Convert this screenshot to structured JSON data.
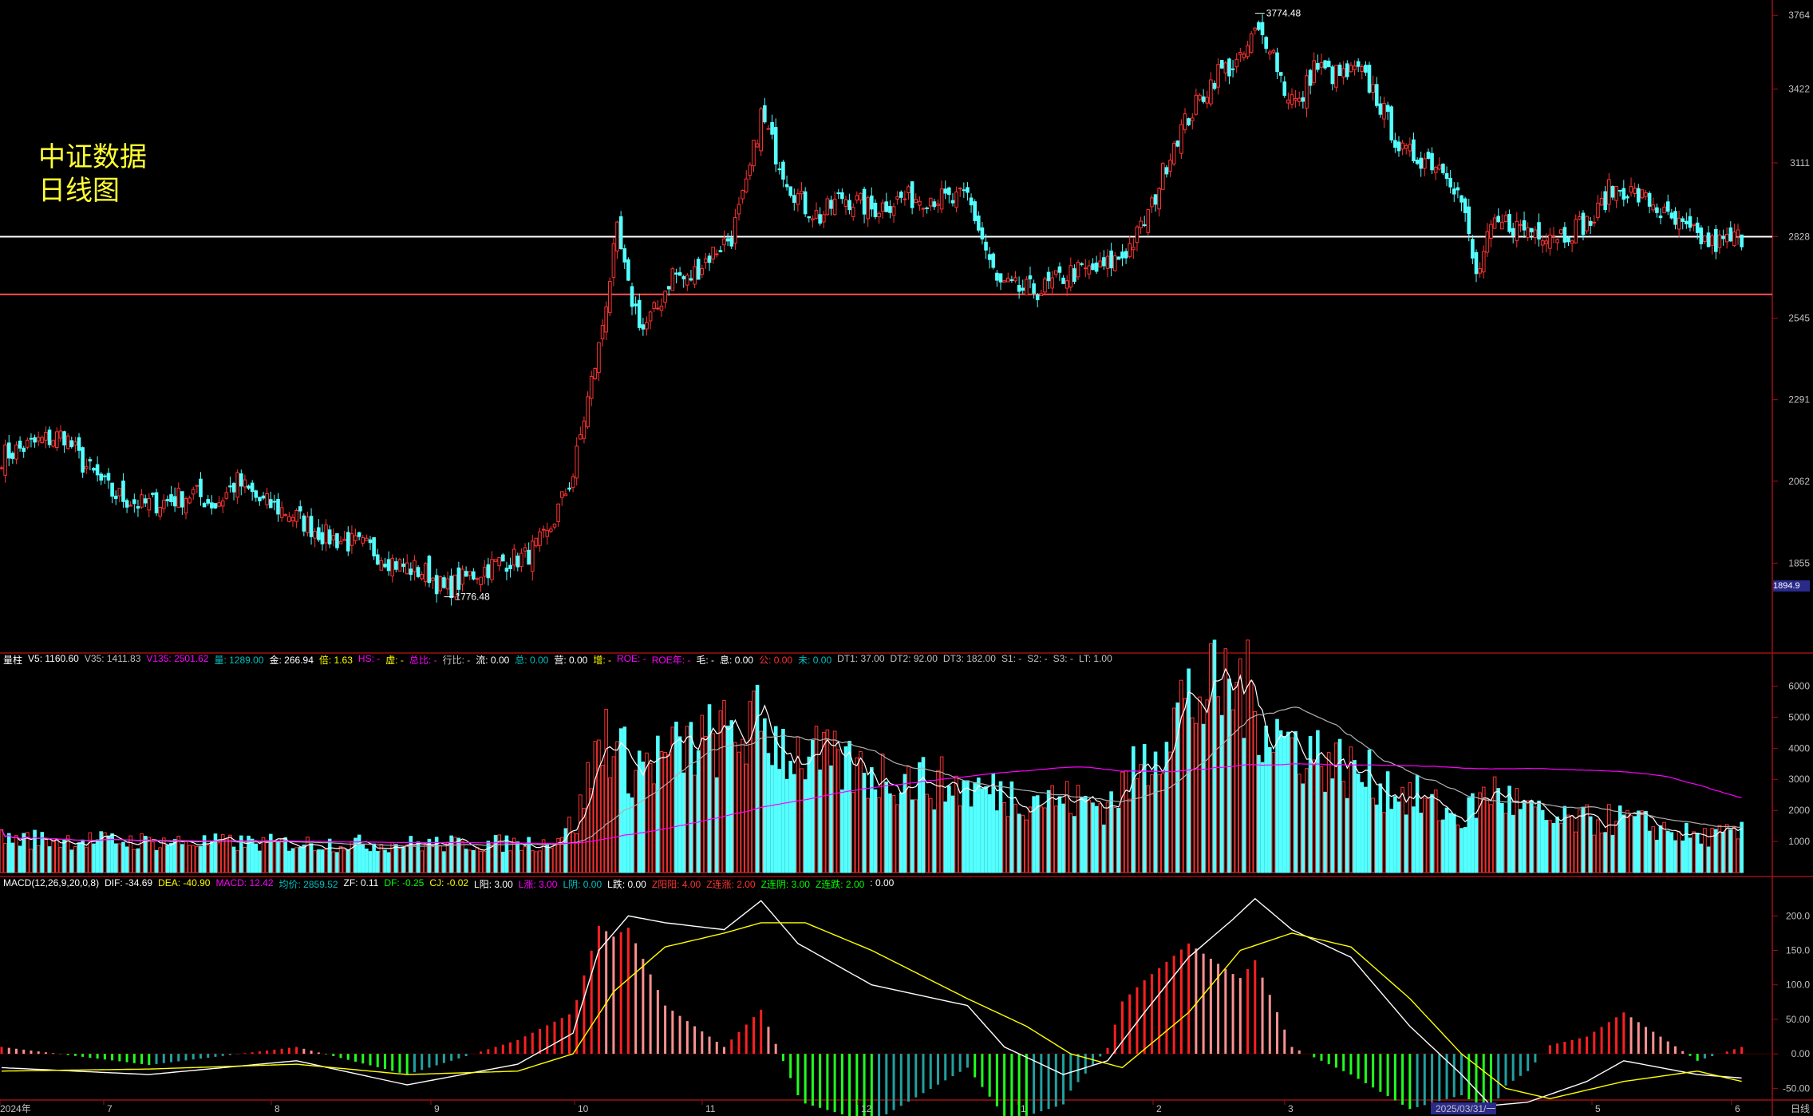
{
  "title": {
    "line1": "中证数据",
    "line2": "日线图"
  },
  "colors": {
    "up": "#ff3232",
    "down": "#54ffff",
    "ma_white": "#ffffff",
    "ma_yellow": "#ffff00",
    "ma_magenta": "#ff00ff",
    "grid_red": "#a01010"
  },
  "price_axis": {
    "ticks": [
      "3764",
      "3422",
      "3111",
      "2828",
      "2545",
      "2291",
      "2062",
      "1855"
    ],
    "current_box": "1894.9"
  },
  "price_annotations": {
    "high": "3774.48",
    "low": "1776.48"
  },
  "support_lines": [
    2828,
    2625
  ],
  "volume_info": [
    {
      "t": "量柱",
      "c": "#ffffff"
    },
    {
      "t": "V5: 1160.60",
      "c": "#ffffff"
    },
    {
      "t": "V35: 1411.83",
      "c": "#c0c0c0"
    },
    {
      "t": "V135: 2501.62",
      "c": "#ff00ff"
    },
    {
      "t": "量: 1289.00",
      "c": "#00c0c0"
    },
    {
      "t": "金: 266.94",
      "c": "#ffffff"
    },
    {
      "t": "倍: 1.63",
      "c": "#ffff00"
    },
    {
      "t": "HS: -",
      "c": "#ff00ff"
    },
    {
      "t": "虚: -",
      "c": "#ffff00"
    },
    {
      "t": "总比: -",
      "c": "#ff00ff"
    },
    {
      "t": "行比: -",
      "c": "#c0c0c0"
    },
    {
      "t": "流: 0.00",
      "c": "#ffffff"
    },
    {
      "t": "总: 0.00",
      "c": "#00c0c0"
    },
    {
      "t": "营: 0.00",
      "c": "#ffffff"
    },
    {
      "t": "增: -",
      "c": "#ffff00"
    },
    {
      "t": "ROE: -",
      "c": "#ff00ff"
    },
    {
      "t": "ROE年: -",
      "c": "#ff00ff"
    },
    {
      "t": "毛: -",
      "c": "#ffffff"
    },
    {
      "t": "息: 0.00",
      "c": "#ffffff"
    },
    {
      "t": "公: 0.00",
      "c": "#ff3232"
    },
    {
      "t": "未: 0.00",
      "c": "#00c0c0"
    },
    {
      "t": "DT1: 37.00",
      "c": "#c0c0c0"
    },
    {
      "t": "DT2: 92.00",
      "c": "#c0c0c0"
    },
    {
      "t": "DT3: 182.00",
      "c": "#c0c0c0"
    },
    {
      "t": "S1: -",
      "c": "#c0c0c0"
    },
    {
      "t": "S2: -",
      "c": "#c0c0c0"
    },
    {
      "t": "S3: -",
      "c": "#c0c0c0"
    },
    {
      "t": "LT: 1.00",
      "c": "#c0c0c0"
    }
  ],
  "volume_axis": {
    "ticks": [
      "6000",
      "5000",
      "4000",
      "3000",
      "2000",
      "1000"
    ]
  },
  "macd_info": [
    {
      "t": "MACD(12,26,9,20,0,8)",
      "c": "#ffffff"
    },
    {
      "t": "DIF: -34.69",
      "c": "#ffffff"
    },
    {
      "t": "DEA: -40.90",
      "c": "#ffff00"
    },
    {
      "t": "MACD: 12.42",
      "c": "#ff00ff"
    },
    {
      "t": "均价: 2859.52",
      "c": "#00c0c0"
    },
    {
      "t": "ZF: 0.11",
      "c": "#ffffff"
    },
    {
      "t": "DF: -0.25",
      "c": "#00ff00"
    },
    {
      "t": "CJ: -0.02",
      "c": "#ffff00"
    },
    {
      "t": "L阳: 3.00",
      "c": "#ffffff"
    },
    {
      "t": "L涨: 3.00",
      "c": "#ff00ff"
    },
    {
      "t": "L阴: 0.00",
      "c": "#00c0c0"
    },
    {
      "t": "L跌: 0.00",
      "c": "#ffffff"
    },
    {
      "t": "Z阳阳: 4.00",
      "c": "#ff3232"
    },
    {
      "t": "Z连涨: 2.00",
      "c": "#ff3232"
    },
    {
      "t": "Z连阴: 3.00",
      "c": "#00ff00"
    },
    {
      "t": "Z连跌: 2.00",
      "c": "#00ff00"
    },
    {
      "t": ": 0.00",
      "c": "#ffffff"
    }
  ],
  "macd_axis": {
    "ticks": [
      "200.0",
      "150.0",
      "100.0",
      "50.00",
      "0.00",
      "-50.00"
    ]
  },
  "x_axis": {
    "labels": [
      "2024年",
      "7",
      "8",
      "9",
      "10",
      "11",
      "12",
      "1",
      "2",
      "3",
      "2025/03/31/一",
      "5",
      "6"
    ],
    "period": "日线"
  },
  "chart_data": [
    {
      "type": "candlestick",
      "title": "中证数据 日线图",
      "ylim": [
        1700,
        3800
      ],
      "scale": "log",
      "close_path": [
        [
          0,
          2130
        ],
        [
          10,
          2170
        ],
        [
          17,
          2190
        ],
        [
          22,
          2110
        ],
        [
          30,
          2030
        ],
        [
          38,
          2000
        ],
        [
          45,
          2010
        ],
        [
          52,
          2030
        ],
        [
          58,
          2000
        ],
        [
          64,
          2060
        ],
        [
          70,
          2010
        ],
        [
          78,
          1980
        ],
        [
          88,
          1920
        ],
        [
          100,
          1890
        ],
        [
          108,
          1850
        ],
        [
          116,
          1830
        ],
        [
          120,
          1790
        ],
        [
          128,
          1830
        ],
        [
          136,
          1860
        ],
        [
          142,
          1870
        ],
        [
          148,
          1920
        ],
        [
          155,
          2080
        ],
        [
          162,
          2450
        ],
        [
          167,
          2840
        ],
        [
          170,
          2640
        ],
        [
          174,
          2510
        ],
        [
          178,
          2580
        ],
        [
          182,
          2700
        ],
        [
          186,
          2670
        ],
        [
          192,
          2760
        ],
        [
          198,
          2830
        ],
        [
          202,
          3010
        ],
        [
          206,
          3310
        ],
        [
          210,
          3150
        ],
        [
          214,
          3020
        ],
        [
          218,
          2940
        ],
        [
          222,
          2900
        ],
        [
          228,
          2980
        ],
        [
          236,
          2930
        ],
        [
          244,
          2970
        ],
        [
          252,
          2980
        ],
        [
          258,
          2960
        ],
        [
          262,
          2980
        ],
        [
          266,
          2820
        ],
        [
          270,
          2660
        ],
        [
          276,
          2640
        ],
        [
          282,
          2640
        ],
        [
          290,
          2700
        ],
        [
          298,
          2710
        ],
        [
          304,
          2760
        ],
        [
          308,
          2830
        ],
        [
          312,
          2940
        ],
        [
          318,
          3200
        ],
        [
          324,
          3350
        ],
        [
          330,
          3500
        ],
        [
          336,
          3540
        ],
        [
          340,
          3680
        ],
        [
          344,
          3640
        ],
        [
          348,
          3420
        ],
        [
          352,
          3350
        ],
        [
          356,
          3530
        ],
        [
          360,
          3490
        ],
        [
          364,
          3480
        ],
        [
          368,
          3500
        ],
        [
          372,
          3420
        ],
        [
          376,
          3280
        ],
        [
          380,
          3150
        ],
        [
          386,
          3130
        ],
        [
          392,
          3090
        ],
        [
          396,
          2960
        ],
        [
          400,
          2680
        ],
        [
          404,
          2850
        ],
        [
          408,
          2880
        ],
        [
          412,
          2860
        ],
        [
          418,
          2850
        ],
        [
          424,
          2840
        ],
        [
          428,
          2870
        ],
        [
          432,
          2890
        ],
        [
          436,
          3000
        ],
        [
          440,
          3010
        ],
        [
          444,
          2980
        ],
        [
          448,
          2950
        ],
        [
          452,
          2890
        ],
        [
          458,
          2840
        ],
        [
          464,
          2800
        ],
        [
          468,
          2810
        ],
        [
          472,
          2830
        ]
      ],
      "highlights": {
        "high": "3774.48",
        "low": "1776.48"
      }
    },
    {
      "type": "bar",
      "title": "量柱",
      "ylim": [
        0,
        6500
      ],
      "v5": "1160.60",
      "v35": "1411.83",
      "v135": "2501.62",
      "volume_path": [
        [
          0,
          1150
        ],
        [
          60,
          1000
        ],
        [
          120,
          960
        ],
        [
          148,
          1000
        ],
        [
          156,
          1700
        ],
        [
          160,
          3500
        ],
        [
          164,
          4800
        ],
        [
          170,
          3600
        ],
        [
          180,
          3900
        ],
        [
          188,
          4300
        ],
        [
          200,
          4700
        ],
        [
          206,
          5000
        ],
        [
          214,
          4100
        ],
        [
          230,
          3500
        ],
        [
          250,
          3100
        ],
        [
          270,
          2700
        ],
        [
          300,
          2300
        ],
        [
          310,
          3700
        ],
        [
          320,
          5700
        ],
        [
          330,
          6100
        ],
        [
          336,
          6400
        ],
        [
          340,
          5600
        ],
        [
          348,
          4500
        ],
        [
          360,
          3800
        ],
        [
          372,
          3100
        ],
        [
          384,
          2500
        ],
        [
          396,
          1800
        ],
        [
          404,
          2800
        ],
        [
          420,
          1700
        ],
        [
          440,
          1800
        ],
        [
          460,
          1200
        ],
        [
          472,
          1300
        ]
      ]
    },
    {
      "type": "bar",
      "title": "MACD(12,26,9,20,0,8)",
      "ylim": [
        -60,
        220
      ],
      "dif": "-34.69",
      "dea": "-40.90",
      "macd": "12.42",
      "dif_path": [
        [
          0,
          -20
        ],
        [
          40,
          -30
        ],
        [
          80,
          -10
        ],
        [
          110,
          -45
        ],
        [
          140,
          -15
        ],
        [
          155,
          30
        ],
        [
          162,
          150
        ],
        [
          170,
          200
        ],
        [
          180,
          190
        ],
        [
          196,
          180
        ],
        [
          206,
          222
        ],
        [
          216,
          160
        ],
        [
          236,
          100
        ],
        [
          262,
          70
        ],
        [
          272,
          10
        ],
        [
          288,
          -30
        ],
        [
          300,
          -10
        ],
        [
          310,
          60
        ],
        [
          322,
          140
        ],
        [
          334,
          195
        ],
        [
          340,
          225
        ],
        [
          350,
          180
        ],
        [
          366,
          140
        ],
        [
          382,
          40
        ],
        [
          396,
          -30
        ],
        [
          404,
          -75
        ],
        [
          414,
          -70
        ],
        [
          430,
          -40
        ],
        [
          440,
          -10
        ],
        [
          460,
          -30
        ],
        [
          472,
          -35
        ]
      ],
      "dea_path": [
        [
          0,
          -25
        ],
        [
          40,
          -22
        ],
        [
          80,
          -15
        ],
        [
          110,
          -30
        ],
        [
          140,
          -25
        ],
        [
          155,
          0
        ],
        [
          166,
          90
        ],
        [
          180,
          155
        ],
        [
          196,
          175
        ],
        [
          206,
          190
        ],
        [
          218,
          190
        ],
        [
          236,
          150
        ],
        [
          262,
          80
        ],
        [
          278,
          40
        ],
        [
          290,
          0
        ],
        [
          304,
          -20
        ],
        [
          322,
          60
        ],
        [
          336,
          150
        ],
        [
          350,
          175
        ],
        [
          366,
          155
        ],
        [
          382,
          80
        ],
        [
          396,
          0
        ],
        [
          408,
          -50
        ],
        [
          420,
          -65
        ],
        [
          440,
          -40
        ],
        [
          460,
          -25
        ],
        [
          472,
          -40
        ]
      ]
    }
  ]
}
